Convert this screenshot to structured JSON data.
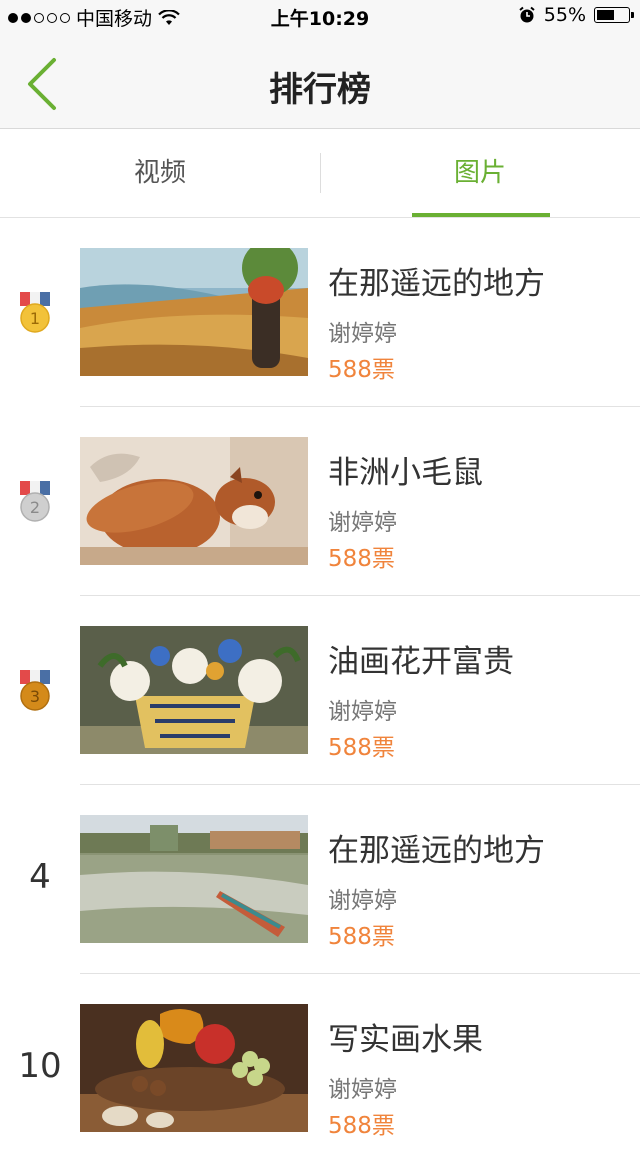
{
  "status_bar": {
    "carrier": "中国移动",
    "time": "上午10:29",
    "battery": "55%",
    "battery_level": 0.55,
    "signal_bars_filled": 2,
    "icons": [
      "signal-dots",
      "wifi-icon",
      "alarm-icon",
      "battery-icon"
    ]
  },
  "nav": {
    "title": "排行榜",
    "back_icon": "chevron-left-icon",
    "accent": "#6ab033"
  },
  "tabs": [
    {
      "label": "视频",
      "active": false
    },
    {
      "label": "图片",
      "active": true
    }
  ],
  "items": [
    {
      "rank": "1",
      "medal": "gold",
      "title": "在那遥远的地方",
      "author": "谢婷婷",
      "votes": "588票",
      "thumb": "lakeside-painting"
    },
    {
      "rank": "2",
      "medal": "silver",
      "title": "非洲小毛鼠",
      "author": "谢婷婷",
      "votes": "588票",
      "thumb": "squirrel"
    },
    {
      "rank": "3",
      "medal": "bronze",
      "title": "油画花开富贵",
      "author": "谢婷婷",
      "votes": "588票",
      "thumb": "flower-vase"
    },
    {
      "rank": "4",
      "medal": null,
      "title": "在那遥远的地方",
      "author": "谢婷婷",
      "votes": "588票",
      "thumb": "lake-boat"
    },
    {
      "rank": "10",
      "medal": null,
      "title": "写实画水果",
      "author": "谢婷婷",
      "votes": "588票",
      "thumb": "fruit-still-life"
    }
  ],
  "colors": {
    "accent_green": "#6ab033",
    "votes_orange": "#f0843c",
    "gold": "#f2c23a",
    "silver": "#c8c8c8",
    "bronze": "#d48a1a"
  }
}
